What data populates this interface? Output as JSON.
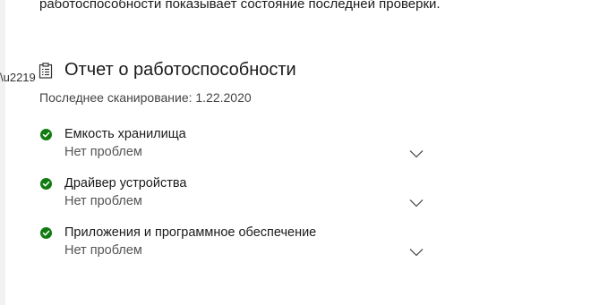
{
  "intro": {
    "text": "работоспособности показывает состояние последней проверки."
  },
  "report": {
    "title": "Отчет о работоспособности",
    "icon": "clipboard-icon",
    "last_scan": "Последнее сканирование: 1.22.2020"
  },
  "items": [
    {
      "title": "Емкость хранилища",
      "status": "Нет проблем",
      "state": "ok"
    },
    {
      "title": "Драйвер устройства",
      "status": "Нет проблем",
      "state": "ok"
    },
    {
      "title": "Приложения и программное обеспечение",
      "status": "Нет проблем",
      "state": "ok"
    }
  ],
  "colors": {
    "ok_green": "#107c10",
    "accent_blue": "#0067c0"
  }
}
